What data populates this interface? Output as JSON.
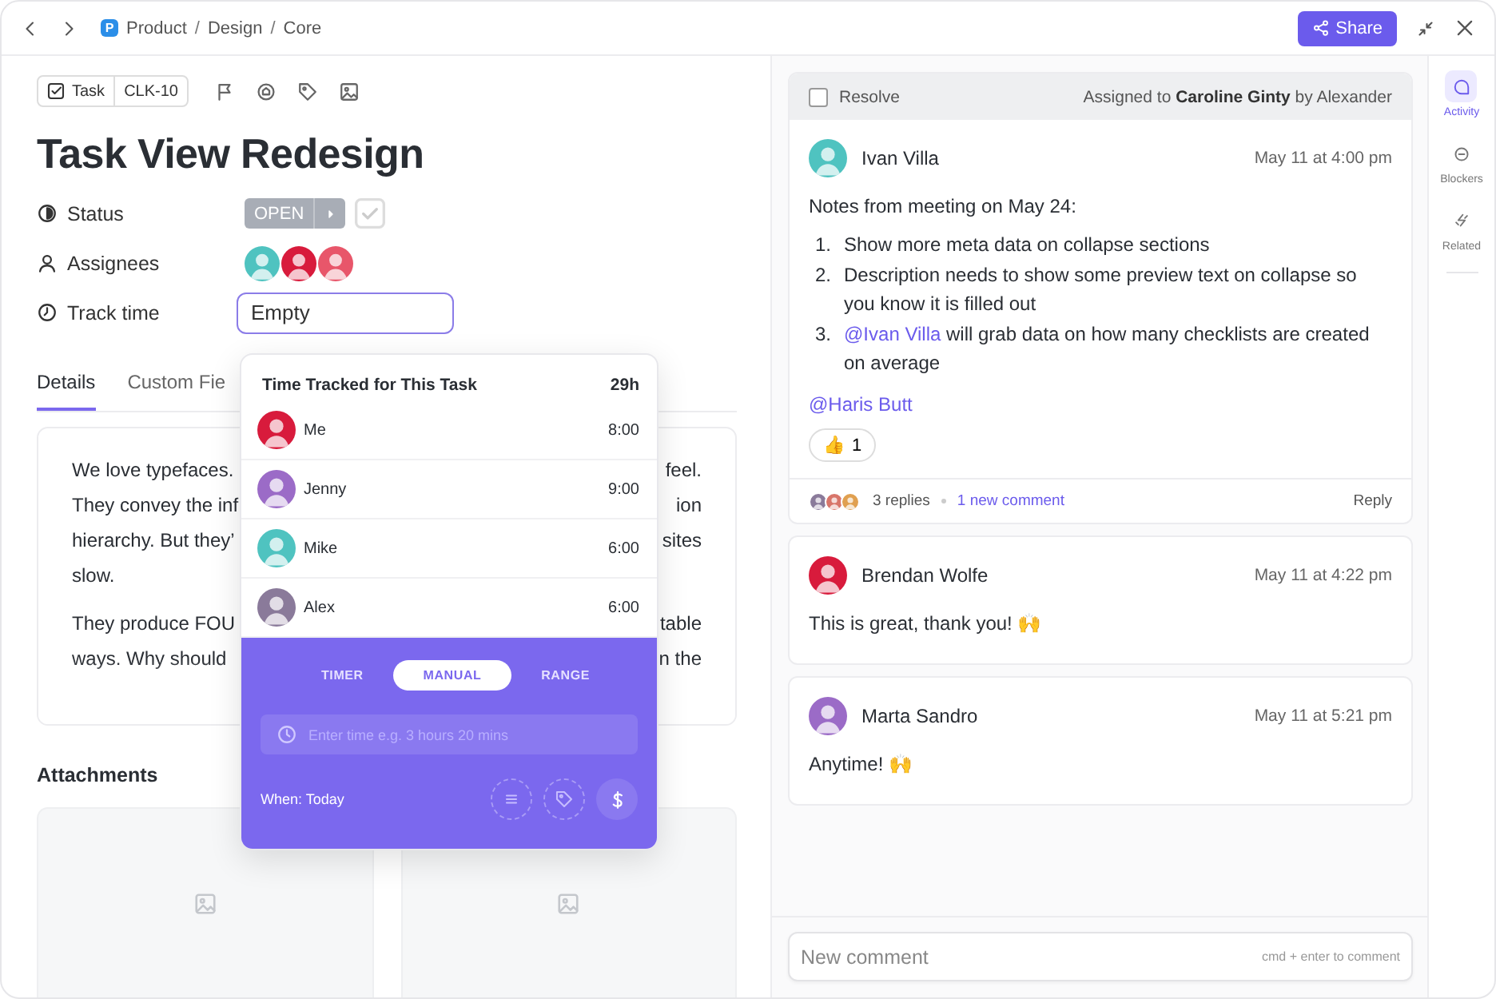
{
  "toolbar": {
    "breadcrumb": {
      "badge": "P",
      "separator": "/",
      "items": [
        "Product",
        "Design",
        "Core"
      ]
    },
    "share_label": "Share"
  },
  "task": {
    "type_label": "Task",
    "id": "CLK-10",
    "title": "Task View Redesign",
    "fields": [
      {
        "kind": "status",
        "label": "Status",
        "value": "OPEN"
      },
      {
        "kind": "assignees",
        "label": "Assignees",
        "avatars": [
          {
            "color": "#4fc3c0"
          },
          {
            "color": "#d81b3c"
          },
          {
            "color": "#e8566a"
          }
        ]
      },
      {
        "kind": "time",
        "label": "Track time",
        "value": "Empty"
      }
    ],
    "tabs": [
      {
        "label": "Details",
        "selected": true
      },
      {
        "label": "Custom Fie",
        "selected": false
      }
    ],
    "description": [
      [
        {
          "left": "We love typefaces.",
          "right": "feel."
        },
        {
          "left": "They convey the inf",
          "right": "ion"
        },
        {
          "left": "hierarchy. But they’",
          "right": "sites"
        },
        {
          "left": "slow."
        }
      ],
      [
        {
          "left": "They produce FOU",
          "right": "table"
        },
        {
          "left": "ways. Why should",
          "right": "n the"
        }
      ]
    ],
    "attachments": {
      "title": "Attachments",
      "previews": [
        {
          "kind": "image"
        },
        {
          "kind": "image"
        }
      ]
    }
  },
  "time_popup": {
    "title": "Time Tracked for This Task",
    "total": "29h",
    "entries": [
      {
        "name": "Me",
        "time": "8:00",
        "color": "#d81b3c"
      },
      {
        "name": "Jenny",
        "time": "9:00",
        "color": "#9b6bc7"
      },
      {
        "name": "Mike",
        "time": "6:00",
        "color": "#4fc3c0"
      },
      {
        "name": "Alex",
        "time": "6:00",
        "color": "#8a7a9a"
      }
    ],
    "modes": [
      {
        "label": "TIMER",
        "selected": false
      },
      {
        "label": "MANUAL",
        "selected": true
      },
      {
        "label": "RANGE",
        "selected": false
      }
    ],
    "input": {
      "placeholder": "Enter time e.g. 3 hours 20 mins"
    },
    "when": "When: Today"
  },
  "activity": {
    "resolve": {
      "label": "Resolve",
      "checked": false
    },
    "assigned": "Assigned to **Caroline Ginty** by Alexander",
    "comments": [
      {
        "author": "Ivan Villa",
        "time": "May 11 at 4:00 pm",
        "avatar": {
          "color": "#4fc3c0"
        },
        "body": [
          {
            "kind": "p",
            "text": "Notes from meeting on May 24:"
          },
          {
            "kind": "ol",
            "items": [
              {
                "number": "1.",
                "text": "Show more meta data on collapse sections"
              },
              {
                "number": "2.",
                "text": "Description needs to show some preview text on collapse so you know it is filled out"
              },
              {
                "number": "3.",
                "mention": "@Ivan Villa",
                "text": " will grab data on how many checklists are created on average"
              }
            ]
          },
          {
            "kind": "mention",
            "text": "@Haris Butt"
          }
        ],
        "reactions": [
          {
            "emoji": "👍",
            "count": "1"
          }
        ],
        "thread": {
          "replies": "3 replies",
          "new": "1 new comment",
          "reply": "Reply",
          "avatars": [
            {
              "color": "#8a7a9a"
            },
            {
              "color": "#d8756a"
            },
            {
              "color": "#e0a050"
            }
          ]
        }
      },
      {
        "author": "Brendan Wolfe",
        "time": "May 11 at 4:22 pm",
        "avatar": {
          "color": "#d81b3c"
        },
        "body": [
          {
            "kind": "p",
            "text": "This is great, thank you! 🙌"
          }
        ]
      },
      {
        "author": "Marta Sandro",
        "time": "May 11 at 5:21 pm",
        "avatar": {
          "color": "#9b6bc7"
        },
        "body": [
          {
            "kind": "p",
            "text": "Anytime! 🙌"
          }
        ]
      }
    ],
    "composer": {
      "placeholder": "New comment",
      "hint": "cmd + enter to comment"
    }
  },
  "sidebar": [
    {
      "kind": "activity",
      "label": "Activity",
      "selected": true
    },
    {
      "kind": "blockers",
      "label": "Blockers",
      "selected": false
    },
    {
      "kind": "related",
      "label": "Related",
      "selected": false
    }
  ]
}
